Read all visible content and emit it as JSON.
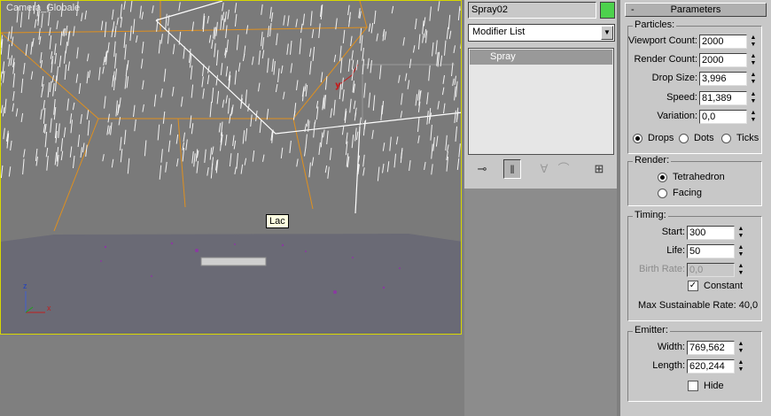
{
  "viewport": {
    "label": "Camera_Globale",
    "tooltip": "Lac"
  },
  "object": {
    "name": "Spray02",
    "color": "#4cd14c"
  },
  "modifier_list": {
    "label": "Modifier List",
    "stack_items": [
      "Spray"
    ]
  },
  "toolbar": {
    "icons": [
      "pin-stack-icon",
      "show-end-result-icon",
      "make-unique-icon",
      "remove-modifier-icon",
      "configure-modifier-sets-icon"
    ]
  },
  "rollout": {
    "title": "Parameters",
    "collapse": "-",
    "particles": {
      "label": "Particles:",
      "viewport_count": {
        "label": "Viewport Count:",
        "value": "2000"
      },
      "render_count": {
        "label": "Render Count:",
        "value": "2000"
      },
      "drop_size": {
        "label": "Drop Size:",
        "value": "3,996"
      },
      "speed": {
        "label": "Speed:",
        "value": "81,389"
      },
      "variation": {
        "label": "Variation:",
        "value": "0,0"
      },
      "drops": "Drops",
      "dots": "Dots",
      "ticks": "Ticks"
    },
    "render": {
      "label": "Render:",
      "tetrahedron": "Tetrahedron",
      "facing": "Facing"
    },
    "timing": {
      "label": "Timing:",
      "start": {
        "label": "Start:",
        "value": "300"
      },
      "life": {
        "label": "Life:",
        "value": "50"
      },
      "birth_rate": {
        "label": "Birth Rate:",
        "value": "0,0"
      },
      "constant": "Constant",
      "max_rate": "Max Sustainable Rate: 40,0"
    },
    "emitter": {
      "label": "Emitter:",
      "width": {
        "label": "Width:",
        "value": "769,562"
      },
      "length": {
        "label": "Length:",
        "value": "620,244"
      },
      "hide": "Hide"
    }
  }
}
